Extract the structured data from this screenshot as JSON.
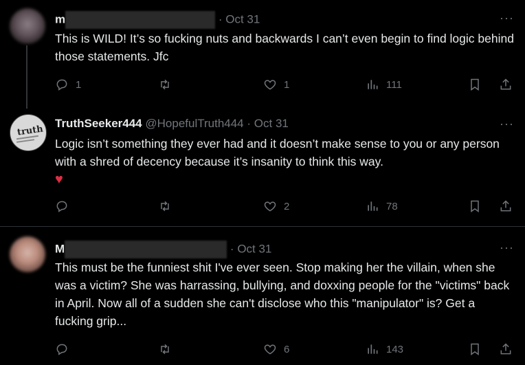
{
  "tweets": [
    {
      "name": "m",
      "handle": "",
      "date": "Oct 31",
      "more": "···",
      "text": "This is WILD! It’s so fucking nuts and backwards I can’t even begin to find logic behind those statements. Jfc",
      "replies": "1",
      "retweets": "",
      "likes": "1",
      "views": "111"
    },
    {
      "name": "TruthSeeker444",
      "handle": "@HopefulTruth444",
      "date": "Oct 31",
      "more": "···",
      "avatar_text": "truth",
      "text": "Logic isn’t something they ever had and it doesn’t make sense to you or any person with a shred of decency because it’s insanity to think this way.",
      "emoji": "♥",
      "replies": "",
      "retweets": "",
      "likes": "2",
      "views": "78"
    },
    {
      "name": "M",
      "handle": "",
      "date": "Oct 31",
      "more": "···",
      "text": "This must be the funniest shit I've ever seen. Stop making her the villain, when she was a victim? She was harrassing, bullying, and doxxing people for the \"victims\" back in April. Now all of a sudden she can't disclose who this \"manipulator\" is? Get a fucking grip...",
      "replies": "",
      "retweets": "",
      "likes": "6",
      "views": "143"
    }
  ],
  "colors": {
    "background": "#000000",
    "text": "#e7e9ea",
    "muted": "#71767b",
    "divider": "#2f3336",
    "heart": "#dd2e44"
  }
}
